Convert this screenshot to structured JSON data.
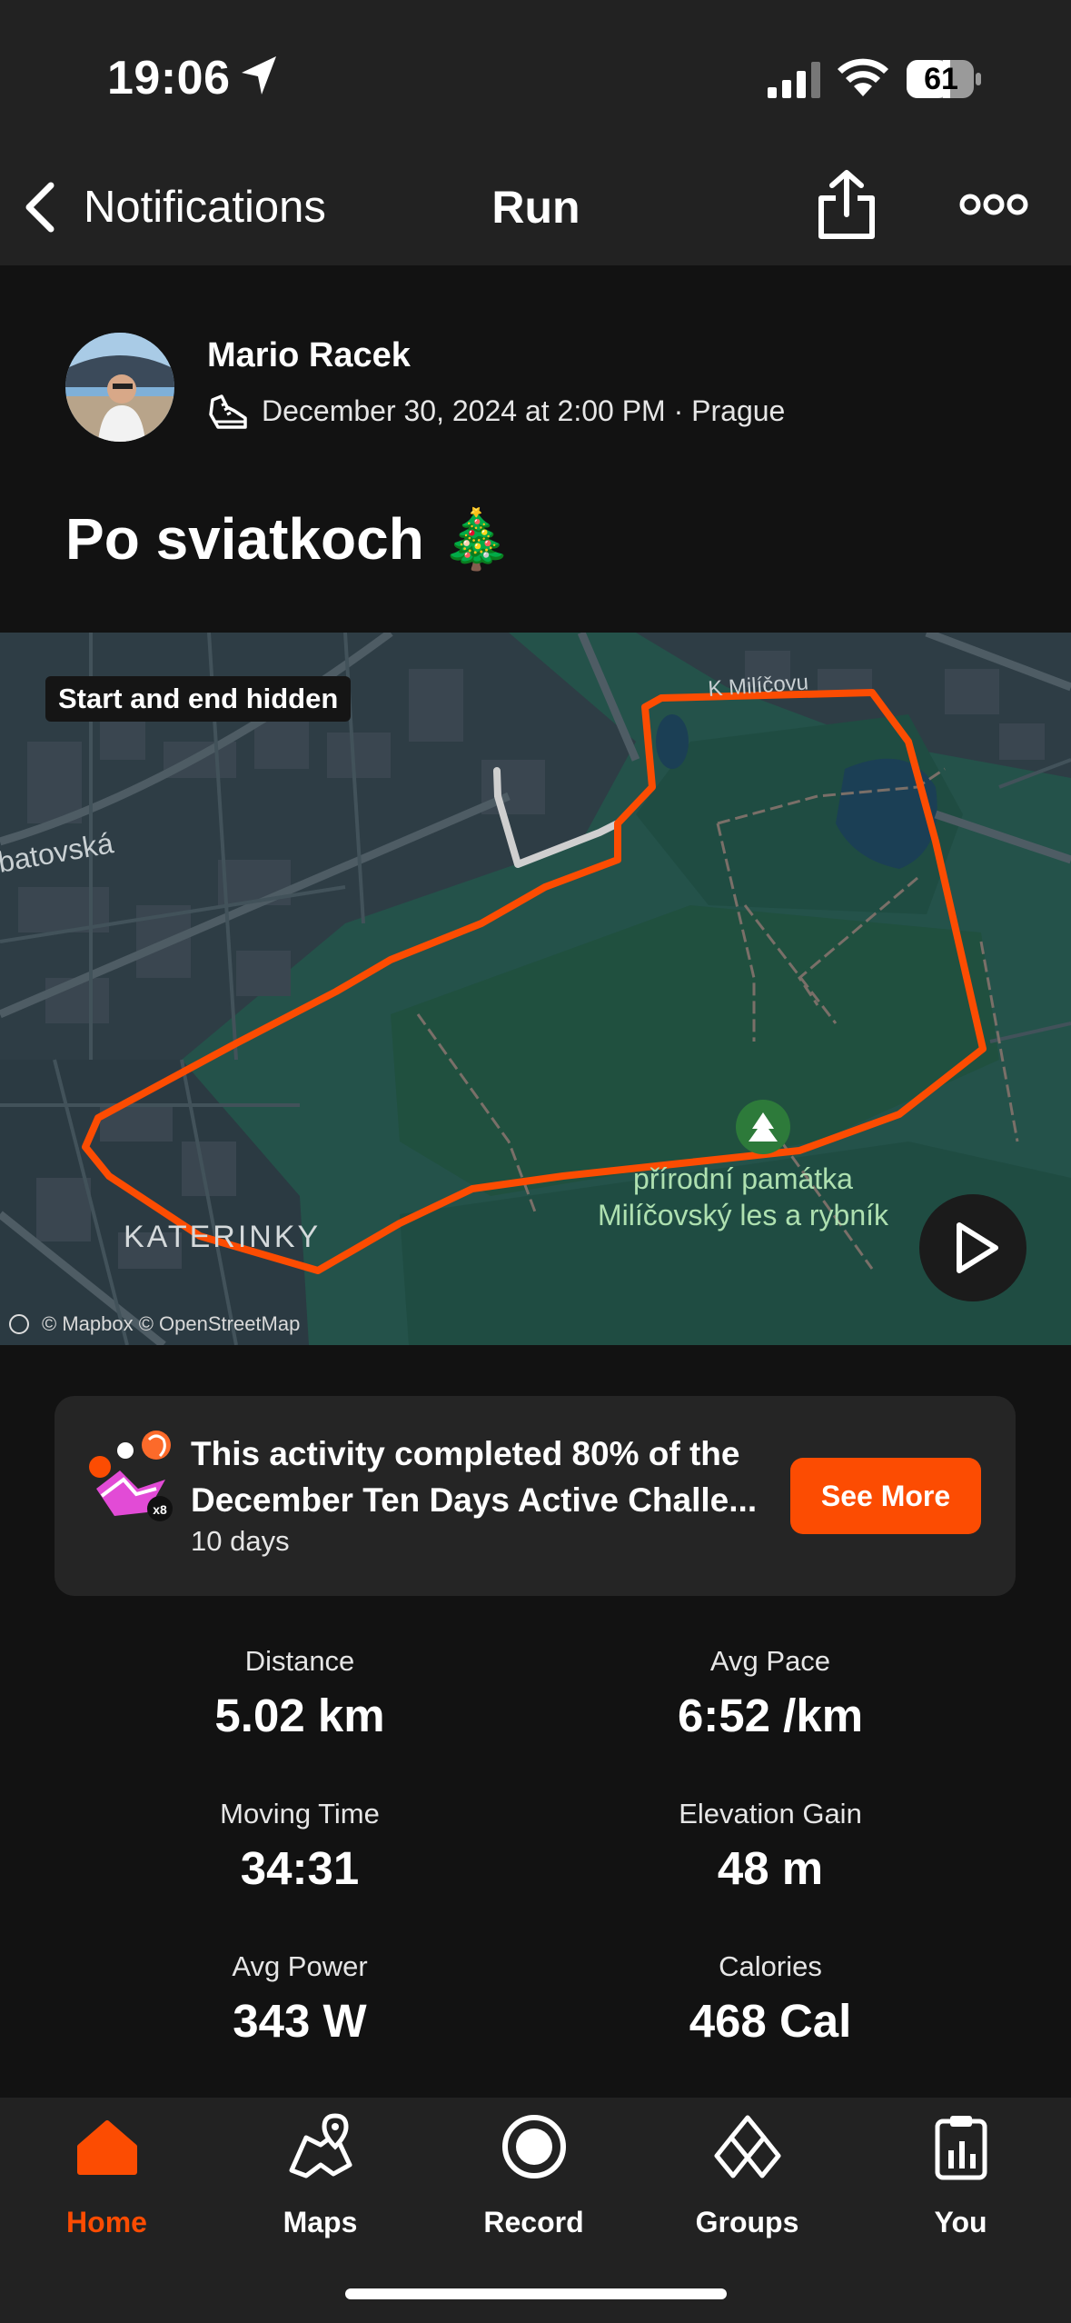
{
  "status_bar": {
    "time": "19:06",
    "battery": "61"
  },
  "nav": {
    "back_label": "Notifications",
    "title": "Run"
  },
  "activity": {
    "athlete": "Mario Racek",
    "meta": "December 30, 2024 at 2:00 PM · Prague",
    "title": "Po sviatkoch 🎄"
  },
  "map": {
    "badge": "Start and end hidden",
    "labels": {
      "street": "batovská",
      "district": "KATERINKY",
      "north_street": "K Milíčovu",
      "park_line1": "přírodní památka",
      "park_line2": "Milíčovský les a rybník"
    },
    "attribution": "© Mapbox © OpenStreetMap",
    "route_color": "#fc4c02"
  },
  "challenge": {
    "text": "This activity completed 80% of the December Ten Days Active Challe...",
    "sub": "10 days",
    "button": "See More"
  },
  "stats": [
    {
      "label": "Distance",
      "value": "5.02 km"
    },
    {
      "label": "Avg Pace",
      "value": "6:52 /km"
    },
    {
      "label": "Moving Time",
      "value": "34:31"
    },
    {
      "label": "Elevation Gain",
      "value": "48 m"
    },
    {
      "label": "Avg Power",
      "value": "343 W"
    },
    {
      "label": "Calories",
      "value": "468 Cal"
    }
  ],
  "tabs": [
    {
      "label": "Home",
      "icon": "home-icon",
      "active": true
    },
    {
      "label": "Maps",
      "icon": "maps-icon"
    },
    {
      "label": "Record",
      "icon": "record-icon"
    },
    {
      "label": "Groups",
      "icon": "groups-icon"
    },
    {
      "label": "You",
      "icon": "you-icon"
    }
  ],
  "colors": {
    "accent": "#fc4c02",
    "background": "#121212",
    "bar": "#222222"
  }
}
